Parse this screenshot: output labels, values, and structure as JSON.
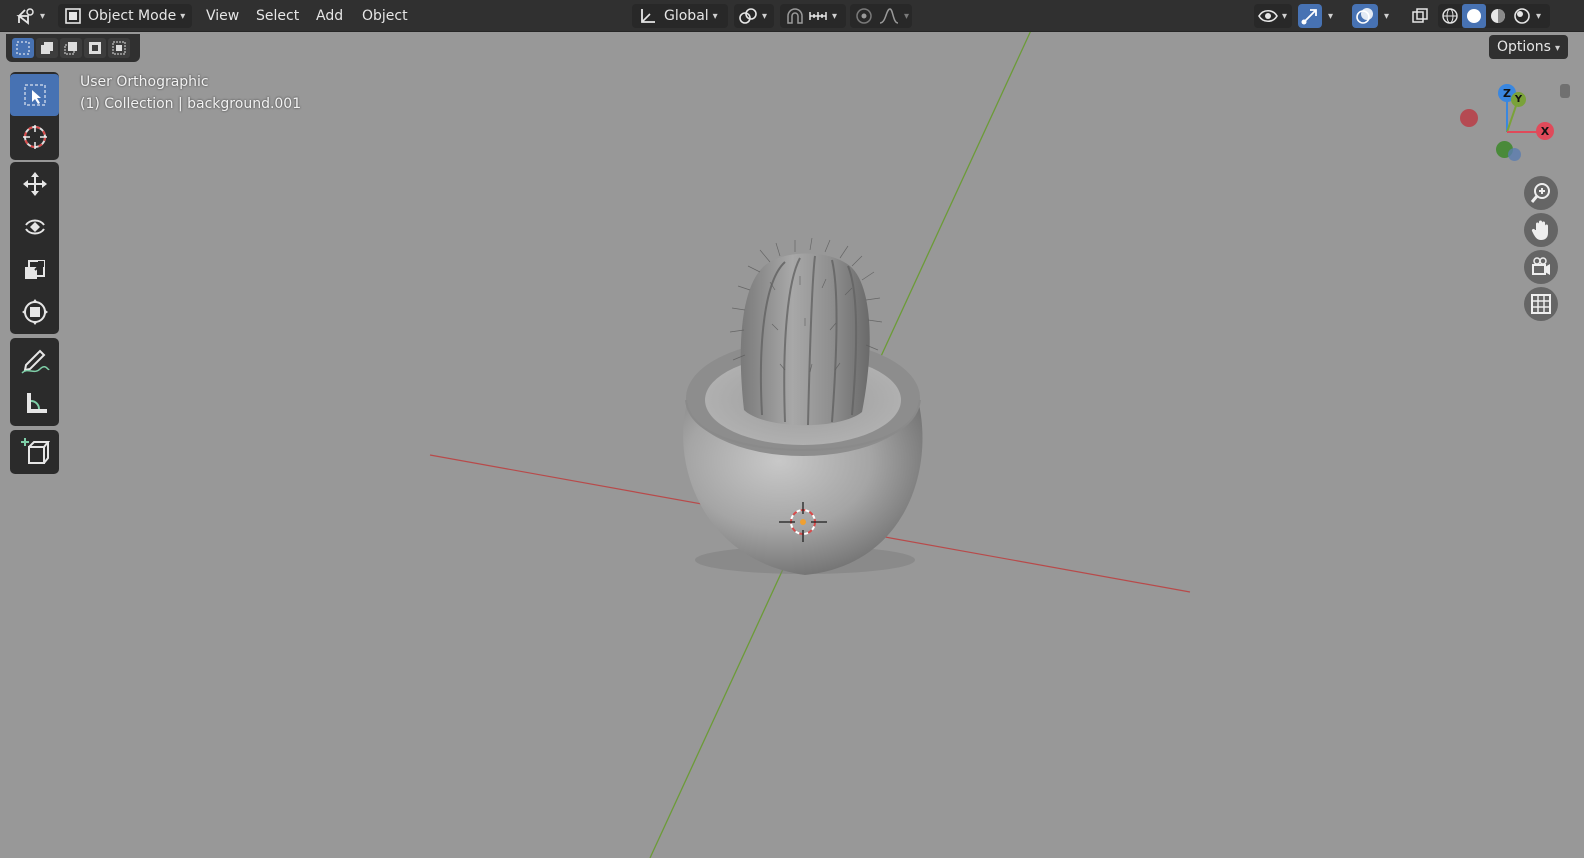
{
  "header": {
    "mode_label": "Object Mode",
    "menus": [
      "View",
      "Select",
      "Add",
      "Object"
    ],
    "orientation_label": "Global"
  },
  "options_label": "Options",
  "overlay": {
    "view_name": "User Orthographic",
    "collection_info": "(1) Collection | background.001"
  },
  "gizmo": {
    "z_label": "Z",
    "y_label": "Y",
    "x_label": "X"
  },
  "colors": {
    "accent": "#4772b3",
    "viewport_bg": "#989898",
    "x_axis": "#e04a5a",
    "y_axis": "#7aa23a",
    "z_axis": "#3a87e0"
  },
  "icons": {
    "editor_type": "3d-viewport-icon",
    "mode": "object-mode-icon",
    "orientation": "transform-orientation-icon",
    "pivot": "pivot-point-icon",
    "snap": "magnet-icon",
    "proportional": "proportional-editing-icon",
    "visibility": "eye-icon",
    "gizmo_toggle": "gizmo-icon",
    "overlay_toggle": "overlay-icon",
    "xray": "xray-icon",
    "shading": [
      "wireframe-icon",
      "solid-icon",
      "material-icon",
      "rendered-icon"
    ],
    "tools": [
      "select-box-icon",
      "cursor-icon",
      "move-icon",
      "rotate-icon",
      "scale-icon",
      "transform-icon",
      "annotate-icon",
      "measure-icon",
      "add-cube-icon"
    ],
    "nav": [
      "zoom-icon",
      "hand-icon",
      "camera-icon",
      "grid-icon"
    ]
  }
}
